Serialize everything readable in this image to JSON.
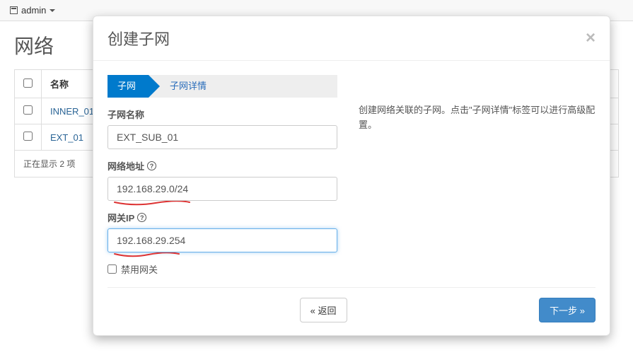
{
  "topnav": {
    "project": "admin"
  },
  "page": {
    "title": "网络",
    "col_name": "名称",
    "rows": [
      {
        "name": "INNER_01"
      },
      {
        "name": "EXT_01"
      }
    ],
    "summary": "正在显示 2 项"
  },
  "modal": {
    "title": "创建子网",
    "steps": {
      "current": "子网",
      "next": "子网详情"
    },
    "form": {
      "name_label": "子网名称",
      "name_value": "EXT_SUB_01",
      "cidr_label": "网络地址",
      "cidr_value": "192.168.29.0/24",
      "gw_label": "网关IP",
      "gw_value": "192.168.29.254",
      "disable_gw_label": "禁用网关"
    },
    "help_text": "创建网络关联的子网。点击\"子网详情\"标签可以进行高级配置。",
    "buttons": {
      "back": "« 返回",
      "next": "下一步 »"
    }
  },
  "icons": {
    "help": "?"
  }
}
